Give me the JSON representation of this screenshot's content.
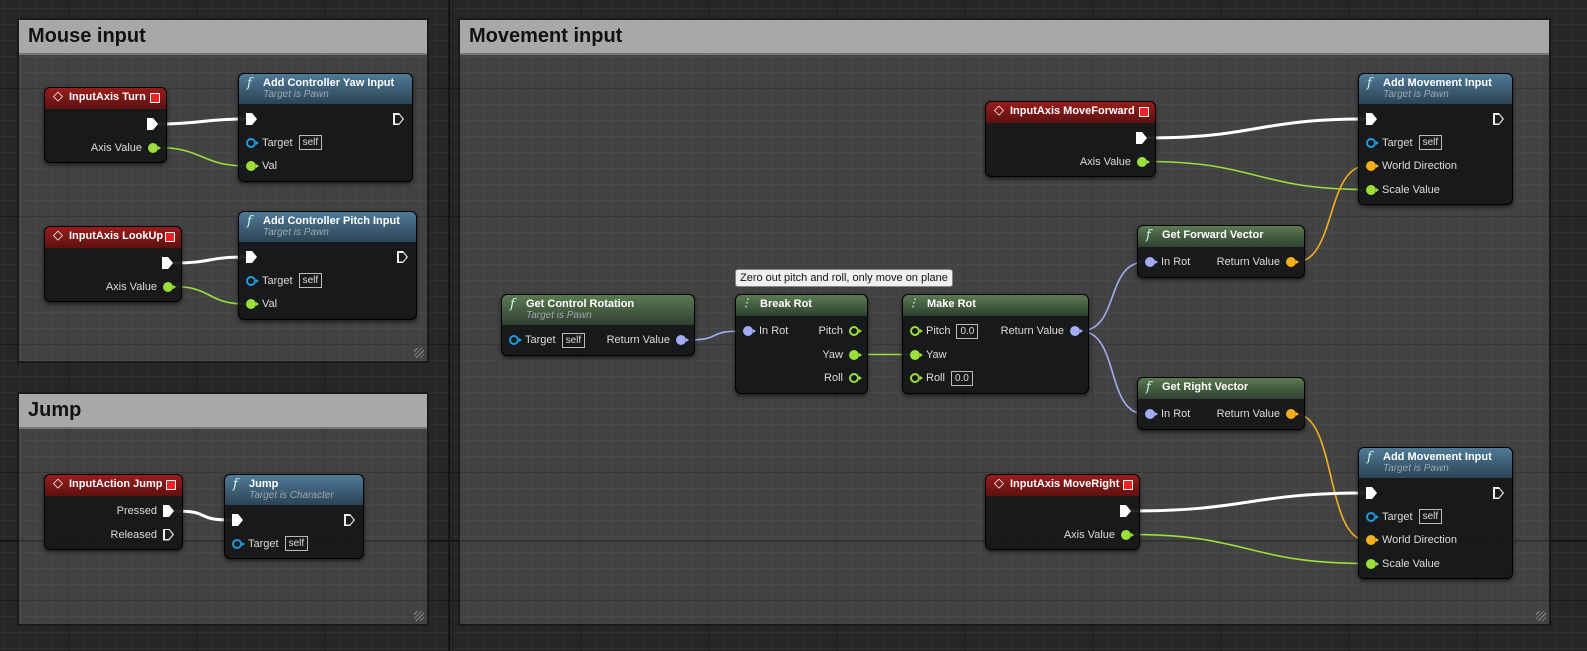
{
  "comments": [
    {
      "id": "mouse",
      "title": "Mouse input"
    },
    {
      "id": "jump",
      "title": "Jump"
    },
    {
      "id": "move",
      "title": "Movement input"
    }
  ],
  "tooltip": "Zero out pitch and roll, only move on plane",
  "colors": {
    "exec": "#ffffff",
    "float": "#9be03a",
    "obj": "#1e9be0",
    "rot": "#a3acf5",
    "vec": "#f3b21c"
  },
  "nodes": [
    {
      "id": "turn",
      "kind": "ev",
      "icon": "event-diamond-icon",
      "title": "InputAxis Turn",
      "left": [],
      "right": [
        {
          "type": "exec",
          "label": ""
        },
        {
          "type": "float",
          "label": "Axis Value"
        }
      ]
    },
    {
      "id": "yaw",
      "kind": "fn",
      "icon": "function-icon",
      "title": "Add Controller Yaw Input",
      "subtitle": "Target is Pawn",
      "left": [
        {
          "type": "exec",
          "label": ""
        },
        {
          "type": "obj",
          "label": "Target",
          "default": "self"
        },
        {
          "type": "float",
          "label": "Val"
        }
      ],
      "right": [
        {
          "type": "exec",
          "label": ""
        }
      ]
    },
    {
      "id": "lookup",
      "kind": "ev",
      "icon": "event-diamond-icon",
      "title": "InputAxis LookUp",
      "left": [],
      "right": [
        {
          "type": "exec",
          "label": ""
        },
        {
          "type": "float",
          "label": "Axis Value"
        }
      ]
    },
    {
      "id": "pitch",
      "kind": "fn",
      "icon": "function-icon",
      "title": "Add Controller Pitch Input",
      "subtitle": "Target is Pawn",
      "left": [
        {
          "type": "exec",
          "label": ""
        },
        {
          "type": "obj",
          "label": "Target",
          "default": "self"
        },
        {
          "type": "float",
          "label": "Val"
        }
      ],
      "right": [
        {
          "type": "exec",
          "label": ""
        }
      ]
    },
    {
      "id": "jumpin",
      "kind": "ev",
      "icon": "event-diamond-icon",
      "title": "InputAction Jump",
      "left": [],
      "right": [
        {
          "type": "exec",
          "label": "Pressed"
        },
        {
          "type": "exec",
          "label": "Released"
        }
      ]
    },
    {
      "id": "jumpfn",
      "kind": "fn",
      "icon": "function-icon",
      "title": "Jump",
      "subtitle": "Target is Character",
      "left": [
        {
          "type": "exec",
          "label": ""
        },
        {
          "type": "obj",
          "label": "Target",
          "default": "self"
        }
      ],
      "right": [
        {
          "type": "exec",
          "label": ""
        }
      ]
    },
    {
      "id": "mf",
      "kind": "ev",
      "icon": "event-diamond-icon",
      "title": "InputAxis MoveForward",
      "left": [],
      "right": [
        {
          "type": "exec",
          "label": ""
        },
        {
          "type": "float",
          "label": "Axis Value"
        }
      ]
    },
    {
      "id": "ami1",
      "kind": "fn",
      "icon": "function-icon",
      "title": "Add Movement Input",
      "subtitle": "Target is Pawn",
      "left": [
        {
          "type": "exec",
          "label": ""
        },
        {
          "type": "obj",
          "label": "Target",
          "default": "self"
        },
        {
          "type": "vec",
          "label": "World Direction"
        },
        {
          "type": "float",
          "label": "Scale Value"
        }
      ],
      "right": [
        {
          "type": "exec",
          "label": ""
        }
      ]
    },
    {
      "id": "gfv",
      "kind": "pure",
      "icon": "function-icon",
      "title": "Get Forward Vector",
      "left": [
        {
          "type": "rot",
          "label": "In Rot"
        }
      ],
      "right": [
        {
          "type": "vec",
          "label": "Return Value"
        }
      ]
    },
    {
      "id": "gcr",
      "kind": "pure",
      "icon": "function-icon",
      "title": "Get Control Rotation",
      "subtitle": "Target is Pawn",
      "left": [
        {
          "type": "obj",
          "label": "Target",
          "default": "self"
        }
      ],
      "right": [
        {
          "type": "rot",
          "label": "Return Value"
        }
      ]
    },
    {
      "id": "brk",
      "kind": "pure",
      "icon": "break-struct-icon",
      "title": "Break Rot",
      "left": [
        {
          "type": "rot",
          "label": "In Rot"
        }
      ],
      "right": [
        {
          "type": "float",
          "label": "Pitch"
        },
        {
          "type": "float",
          "label": "Yaw"
        },
        {
          "type": "float",
          "label": "Roll"
        }
      ]
    },
    {
      "id": "mk",
      "kind": "pure",
      "icon": "make-struct-icon",
      "title": "Make Rot",
      "left": [
        {
          "type": "float",
          "label": "Pitch",
          "default": "0.0"
        },
        {
          "type": "float",
          "label": "Yaw"
        },
        {
          "type": "float",
          "label": "Roll",
          "default": "0.0"
        }
      ],
      "right": [
        {
          "type": "rot",
          "label": "Return Value"
        }
      ]
    },
    {
      "id": "grv",
      "kind": "pure",
      "icon": "function-icon",
      "title": "Get Right Vector",
      "left": [
        {
          "type": "rot",
          "label": "In Rot"
        }
      ],
      "right": [
        {
          "type": "vec",
          "label": "Return Value"
        }
      ]
    },
    {
      "id": "mr",
      "kind": "ev",
      "icon": "event-diamond-icon",
      "title": "InputAxis MoveRight",
      "left": [],
      "right": [
        {
          "type": "exec",
          "label": ""
        },
        {
          "type": "float",
          "label": "Axis Value"
        }
      ]
    },
    {
      "id": "ami2",
      "kind": "fn",
      "icon": "function-icon",
      "title": "Add Movement Input",
      "subtitle": "Target is Pawn",
      "left": [
        {
          "type": "exec",
          "label": ""
        },
        {
          "type": "obj",
          "label": "Target",
          "default": "self"
        },
        {
          "type": "vec",
          "label": "World Direction"
        },
        {
          "type": "float",
          "label": "Scale Value"
        }
      ],
      "right": [
        {
          "type": "exec",
          "label": ""
        }
      ]
    }
  ],
  "connections": [
    [
      "turn.r0",
      "yaw.l0"
    ],
    [
      "turn.r1",
      "yaw.l2"
    ],
    [
      "lookup.r0",
      "pitch.l0"
    ],
    [
      "lookup.r1",
      "pitch.l2"
    ],
    [
      "jumpin.r0",
      "jumpfn.l0"
    ],
    [
      "mf.r0",
      "ami1.l0"
    ],
    [
      "mf.r1",
      "ami1.l3"
    ],
    [
      "gcr.r0",
      "brk.l0"
    ],
    [
      "brk.r1",
      "mk.l1"
    ],
    [
      "mk.r0",
      "gfv.l0"
    ],
    [
      "mk.r0",
      "grv.l0"
    ],
    [
      "gfv.r0",
      "ami1.l2"
    ],
    [
      "grv.r0",
      "ami2.l2"
    ],
    [
      "mr.r0",
      "ami2.l0"
    ],
    [
      "mr.r1",
      "ami2.l3"
    ]
  ]
}
